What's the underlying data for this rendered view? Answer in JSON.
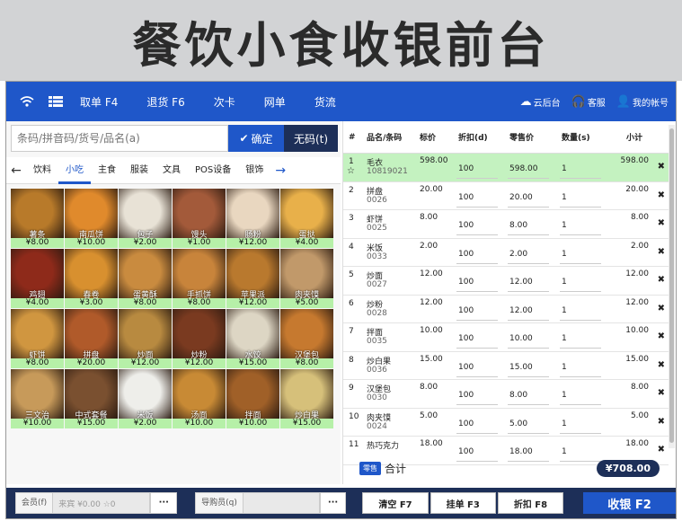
{
  "banner": {
    "title": "餐饮小食收银前台"
  },
  "topbar": {
    "menu": [
      "取单 F4",
      "退货 F6",
      "次卡",
      "网单",
      "货流"
    ],
    "right": [
      {
        "icon": "cloud-icon",
        "label": "云后台"
      },
      {
        "icon": "headset-icon",
        "label": "客服"
      },
      {
        "icon": "user-icon",
        "label": "我的帐号"
      }
    ]
  },
  "search": {
    "placeholder": "条码/拼音码/货号/品名(a)",
    "ok_label": "确定",
    "nocode_label": "无码(t)"
  },
  "categories": [
    "饮料",
    "小吃",
    "主食",
    "服装",
    "文具",
    "POS设备",
    "银饰"
  ],
  "active_category": 1,
  "products": [
    {
      "name": "薯条",
      "price": "¥8.00",
      "color": "#b87a2a"
    },
    {
      "name": "南瓜饼",
      "price": "¥10.00",
      "color": "#e08a2c"
    },
    {
      "name": "包子",
      "price": "¥2.00",
      "color": "#e8e2d6"
    },
    {
      "name": "馒头",
      "price": "¥1.00",
      "color": "#a35a3a"
    },
    {
      "name": "肠粉",
      "price": "¥12.00",
      "color": "#e9d7c0"
    },
    {
      "name": "蛋挞",
      "price": "¥4.00",
      "color": "#e8b04a"
    },
    {
      "name": "鸡翅",
      "price": "¥4.00",
      "color": "#8e2a1a"
    },
    {
      "name": "春卷",
      "price": "¥3.00",
      "color": "#d8902f"
    },
    {
      "name": "蛋黄酥",
      "price": "¥8.00",
      "color": "#c98b3f"
    },
    {
      "name": "手抓饼",
      "price": "¥8.00",
      "color": "#c8843b"
    },
    {
      "name": "苹果派",
      "price": "¥12.00",
      "color": "#b9792e"
    },
    {
      "name": "肉夹馍",
      "price": "¥5.00",
      "color": "#c1996a"
    },
    {
      "name": "虾饼",
      "price": "¥8.00",
      "color": "#d09640"
    },
    {
      "name": "拼盘",
      "price": "¥20.00",
      "color": "#b05a2a"
    },
    {
      "name": "炒面",
      "price": "¥12.00",
      "color": "#b88a40"
    },
    {
      "name": "炒粉",
      "price": "¥12.00",
      "color": "#7a3a20"
    },
    {
      "name": "水饺",
      "price": "¥15.00",
      "color": "#ddd6c4"
    },
    {
      "name": "汉堡包",
      "price": "¥8.00",
      "color": "#c6792f"
    },
    {
      "name": "三文治",
      "price": "¥10.00",
      "color": "#c79a5a"
    },
    {
      "name": "中式套餐",
      "price": "¥15.00",
      "color": "#7a5030"
    },
    {
      "name": "米饭",
      "price": "¥2.00",
      "color": "#eeeeea"
    },
    {
      "name": "汤面",
      "price": "¥10.00",
      "color": "#c88a35"
    },
    {
      "name": "拌面",
      "price": "¥10.00",
      "color": "#a06028"
    },
    {
      "name": "炒白果",
      "price": "¥15.00",
      "color": "#d6c07a"
    }
  ],
  "table": {
    "headers": [
      "#",
      "品名/条码",
      "标价",
      "折扣(d)",
      "零售价",
      "数量(s)",
      "小计"
    ],
    "rows": [
      {
        "no": "1",
        "name": "毛衣",
        "code": "10819021",
        "price": "598.00",
        "discount": "100",
        "sale": "598.00",
        "qty": "1",
        "subtotal": "598.00"
      },
      {
        "no": "2",
        "name": "拼盘",
        "code": "0026",
        "price": "20.00",
        "discount": "100",
        "sale": "20.00",
        "qty": "1",
        "subtotal": "20.00"
      },
      {
        "no": "3",
        "name": "虾饼",
        "code": "0025",
        "price": "8.00",
        "discount": "100",
        "sale": "8.00",
        "qty": "1",
        "subtotal": "8.00"
      },
      {
        "no": "4",
        "name": "米饭",
        "code": "0033",
        "price": "2.00",
        "discount": "100",
        "sale": "2.00",
        "qty": "1",
        "subtotal": "2.00"
      },
      {
        "no": "5",
        "name": "炒面",
        "code": "0027",
        "price": "12.00",
        "discount": "100",
        "sale": "12.00",
        "qty": "1",
        "subtotal": "12.00"
      },
      {
        "no": "6",
        "name": "炒粉",
        "code": "0028",
        "price": "12.00",
        "discount": "100",
        "sale": "12.00",
        "qty": "1",
        "subtotal": "12.00"
      },
      {
        "no": "7",
        "name": "拌面",
        "code": "0035",
        "price": "10.00",
        "discount": "100",
        "sale": "10.00",
        "qty": "1",
        "subtotal": "10.00"
      },
      {
        "no": "8",
        "name": "炒白果",
        "code": "0036",
        "price": "15.00",
        "discount": "100",
        "sale": "15.00",
        "qty": "1",
        "subtotal": "15.00"
      },
      {
        "no": "9",
        "name": "汉堡包",
        "code": "0030",
        "price": "8.00",
        "discount": "100",
        "sale": "8.00",
        "qty": "1",
        "subtotal": "8.00"
      },
      {
        "no": "10",
        "name": "肉夹馍",
        "code": "0024",
        "price": "5.00",
        "discount": "100",
        "sale": "5.00",
        "qty": "1",
        "subtotal": "5.00"
      },
      {
        "no": "11",
        "name": "热巧克力",
        "code": "",
        "price": "18.00",
        "discount": "100",
        "sale": "18.00",
        "qty": "1",
        "subtotal": "18.00"
      }
    ]
  },
  "total": {
    "badge": "零售",
    "label": "合计",
    "amount": "¥708.00"
  },
  "bottom": {
    "member_label": "会员(f)",
    "member_value": "来宾 ¥0.00 ☆0",
    "guide_label": "导购员(q)",
    "clear": "清空 F7",
    "hang": "挂单 F3",
    "discount": "折扣 F8",
    "pay": "收银 F2"
  },
  "colors": {
    "accent": "#1f57c9",
    "dark": "#1d2f58",
    "selected_row": "#c4f2c0"
  }
}
